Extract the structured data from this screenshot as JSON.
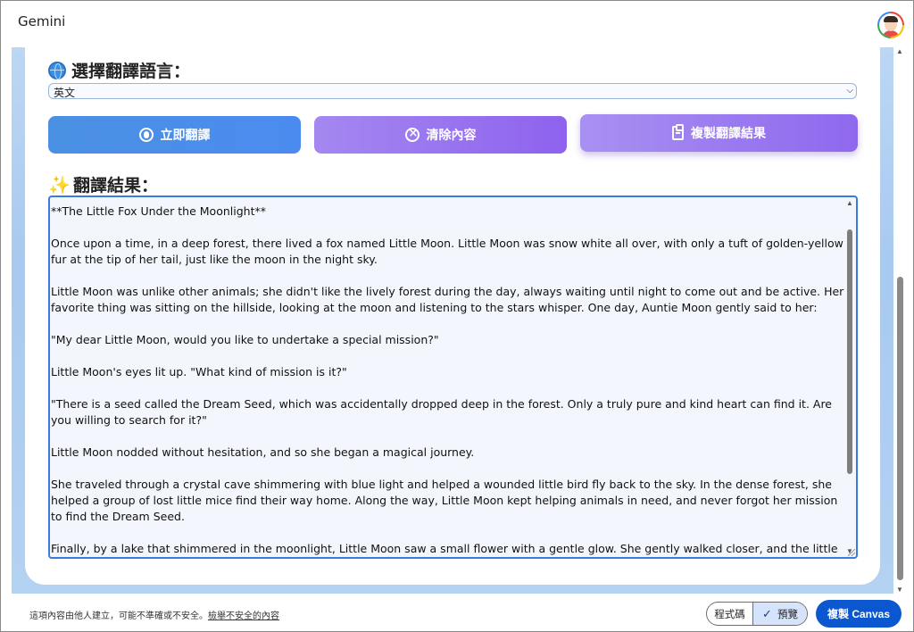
{
  "app": {
    "title": "Gemini"
  },
  "language_section": {
    "title": "選擇翻譯語言：",
    "selected": "英文"
  },
  "buttons": {
    "translate": "立即翻譯",
    "clear": "清除內容",
    "copy": "複製翻譯結果"
  },
  "result_section": {
    "title": "翻譯結果：",
    "paragraphs": [
      "**The Little Fox Under the Moonlight**",
      "Once upon a time, in a deep forest, there lived a fox named Little Moon. Little Moon was snow white all over, with only a tuft of golden-yellow fur at the tip of her tail, just like the moon in the night sky.",
      "Little Moon was unlike other animals; she didn't like the lively forest during the day, always waiting until night to come out and be active. Her favorite thing was sitting on the hillside, looking at the moon and listening to the stars whisper. One day, Auntie Moon gently said to her:",
      "\"My dear Little Moon, would you like to undertake a special mission?\"",
      "Little Moon's eyes lit up. \"What kind of mission is it?\"",
      "\"There is a seed called the Dream Seed, which was accidentally dropped deep in the forest. Only a truly pure and kind heart can find it. Are you willing to search for it?\"",
      "Little Moon nodded without hesitation, and so she began a magical journey.",
      "She traveled through a crystal cave shimmering with blue light and helped a wounded little bird fly back to the sky. In the dense forest, she helped a group of lost little mice find their way home. Along the way, Little Moon kept helping animals in need, and never forgot her mission to find the Dream Seed.",
      "Finally, by a lake that shimmered in the moonlight, Little Moon saw a small flower with a gentle glow. She gently walked closer, and the little flower surprisingly transformed into a sparkling seed, floating in the air and slowly falling in front of her."
    ]
  },
  "footer": {
    "note": "這項內容由他人建立，可能不準確或不安全。",
    "report_link": "檢舉不安全的內容",
    "code_tab": "程式碼",
    "preview_tab": "預覽",
    "canvas_button": "複製 Canvas"
  },
  "colors": {
    "translate_button": "#4a90e2",
    "clear_button": "#8e62ee",
    "copy_button": "#9a78f0",
    "canvas_button": "#0b57d0",
    "result_border": "#3a7be0"
  },
  "icons": {
    "language": "globe-icon",
    "result": "sparkle-icon",
    "translate": "microphone-icon",
    "clear": "clear-icon",
    "copy": "clipboard-icon",
    "preview": "check-icon"
  }
}
